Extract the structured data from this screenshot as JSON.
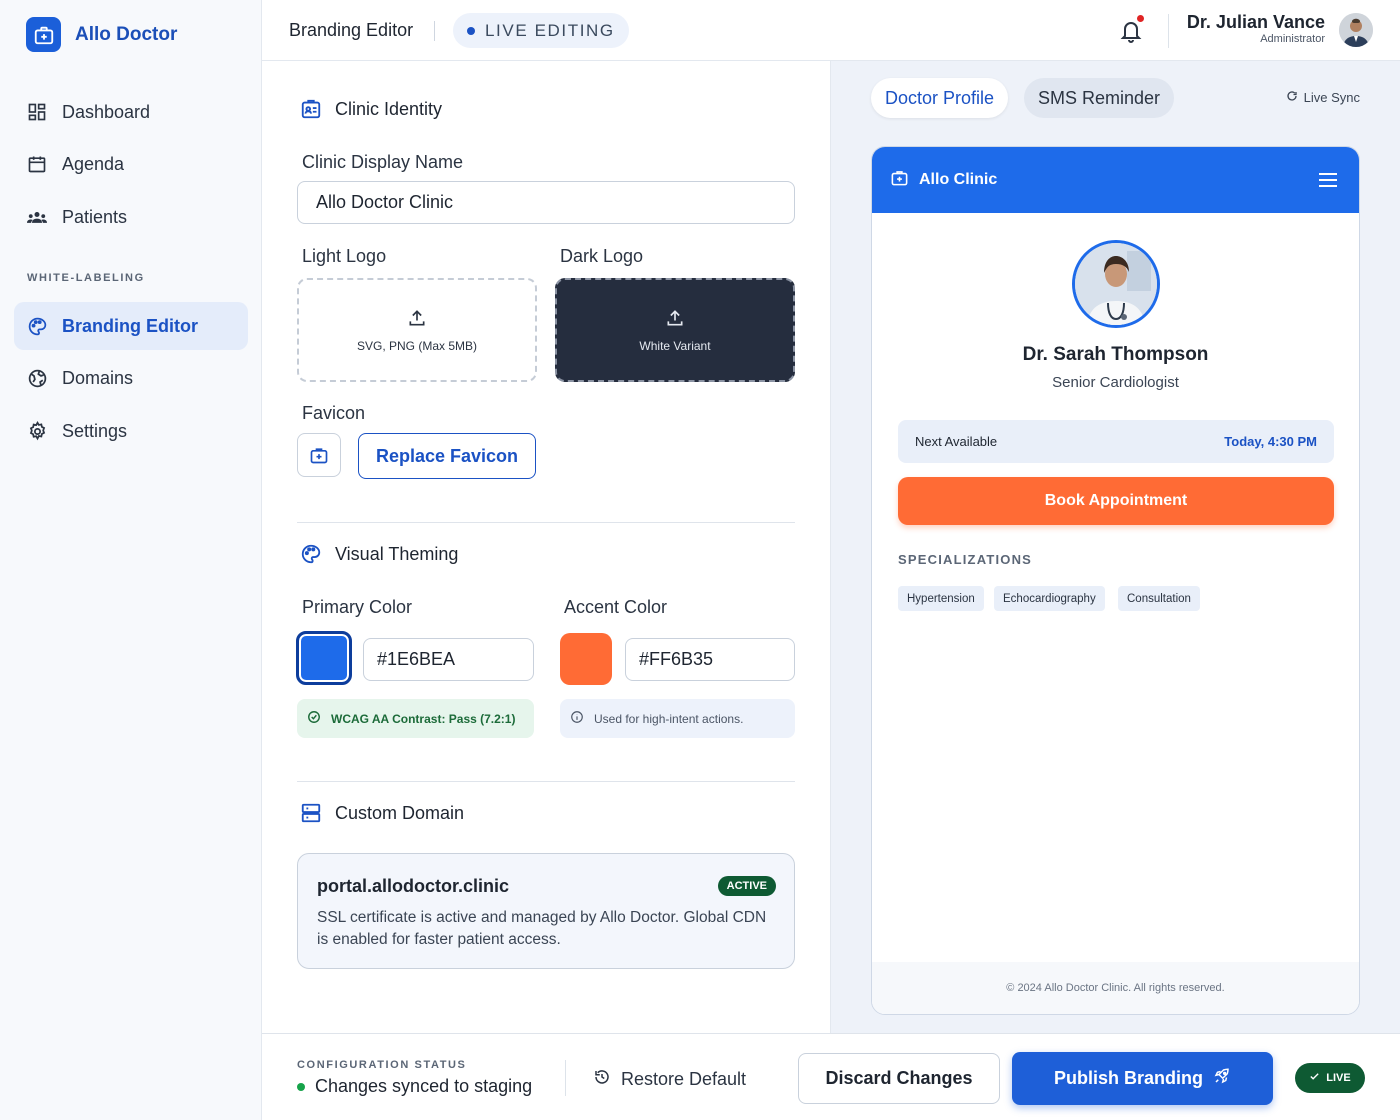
{
  "brand": {
    "name": "Allo Doctor",
    "color": "#1b5fd9"
  },
  "sidebar": {
    "items": [
      {
        "label": "Dashboard",
        "icon": "dashboard-icon"
      },
      {
        "label": "Agenda",
        "icon": "calendar-icon"
      },
      {
        "label": "Patients",
        "icon": "users-icon"
      }
    ],
    "section_label": "WHITE-LABELING",
    "section_items": [
      {
        "label": "Branding Editor",
        "icon": "palette-icon",
        "active": true
      },
      {
        "label": "Domains",
        "icon": "globe-icon"
      },
      {
        "label": "Settings",
        "icon": "gear-icon"
      }
    ]
  },
  "header": {
    "title": "Branding Editor",
    "live_label": "LIVE EDITING",
    "user_name": "Dr. Julian Vance",
    "user_role": "Administrator"
  },
  "editor": {
    "identity": {
      "heading": "Clinic Identity",
      "display_name_label": "Clinic Display Name",
      "display_name_value": "Allo Doctor Clinic",
      "light_logo_label": "Light Logo",
      "light_logo_hint": "SVG, PNG (Max 5MB)",
      "dark_logo_label": "Dark Logo",
      "dark_logo_hint": "White Variant",
      "favicon_label": "Favicon",
      "replace_favicon": "Replace Favicon"
    },
    "theming": {
      "heading": "Visual Theming",
      "primary_label": "Primary Color",
      "primary_value": "#1E6BEA",
      "accent_label": "Accent Color",
      "accent_value": "#FF6B35",
      "contrast_note": "WCAG AA Contrast: Pass (7.2:1)",
      "accent_note": "Used for high-intent actions."
    },
    "domain": {
      "heading": "Custom Domain",
      "name": "portal.allodoctor.clinic",
      "status": "ACTIVE",
      "description": "SSL certificate is active and managed by Allo Doctor. Global CDN is enabled for faster patient access."
    }
  },
  "preview": {
    "tabs": [
      "Doctor Profile",
      "SMS Reminder"
    ],
    "active_tab": "Doctor Profile",
    "sync_label": "Live Sync",
    "clinic_name": "Allo Clinic",
    "doctor_name": "Dr. Sarah Thompson",
    "doctor_role": "Senior Cardiologist",
    "next_available_label": "Next Available",
    "next_available_value": "Today, 4:30 PM",
    "book_label": "Book Appointment",
    "specializations_label": "SPECIALIZATIONS",
    "specializations": [
      "Hypertension",
      "Echocardiography",
      "Consultation"
    ],
    "footer": "© 2024 Allo Doctor Clinic. All rights reserved."
  },
  "footer": {
    "config_label": "CONFIGURATION STATUS",
    "config_status": "Changes synced to staging",
    "restore_label": "Restore Default",
    "discard_label": "Discard Changes",
    "publish_label": "Publish Branding",
    "live_badge": "LIVE"
  },
  "colors": {
    "primary": "#1E6BEA",
    "accent": "#FF6B35",
    "success": "#0e5a33"
  }
}
